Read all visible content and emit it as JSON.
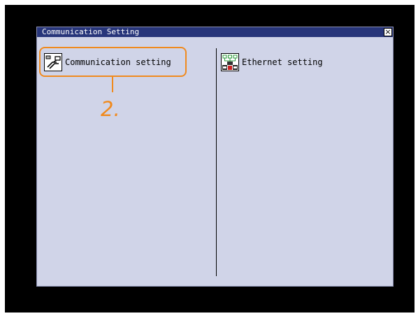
{
  "window": {
    "title": "Communication Setting",
    "close_symbol": "×"
  },
  "menu": {
    "items": [
      {
        "label": "Communication setting",
        "icon": "communication-setting-icon"
      },
      {
        "label": "Ethernet setting",
        "icon": "ethernet-setting-icon"
      }
    ]
  },
  "annotation": {
    "step_label": "2."
  },
  "colors": {
    "titlebar": "#27357a",
    "window_bg": "#d0d4e8",
    "bezel": "#000000",
    "highlight": "#f08a1e"
  }
}
